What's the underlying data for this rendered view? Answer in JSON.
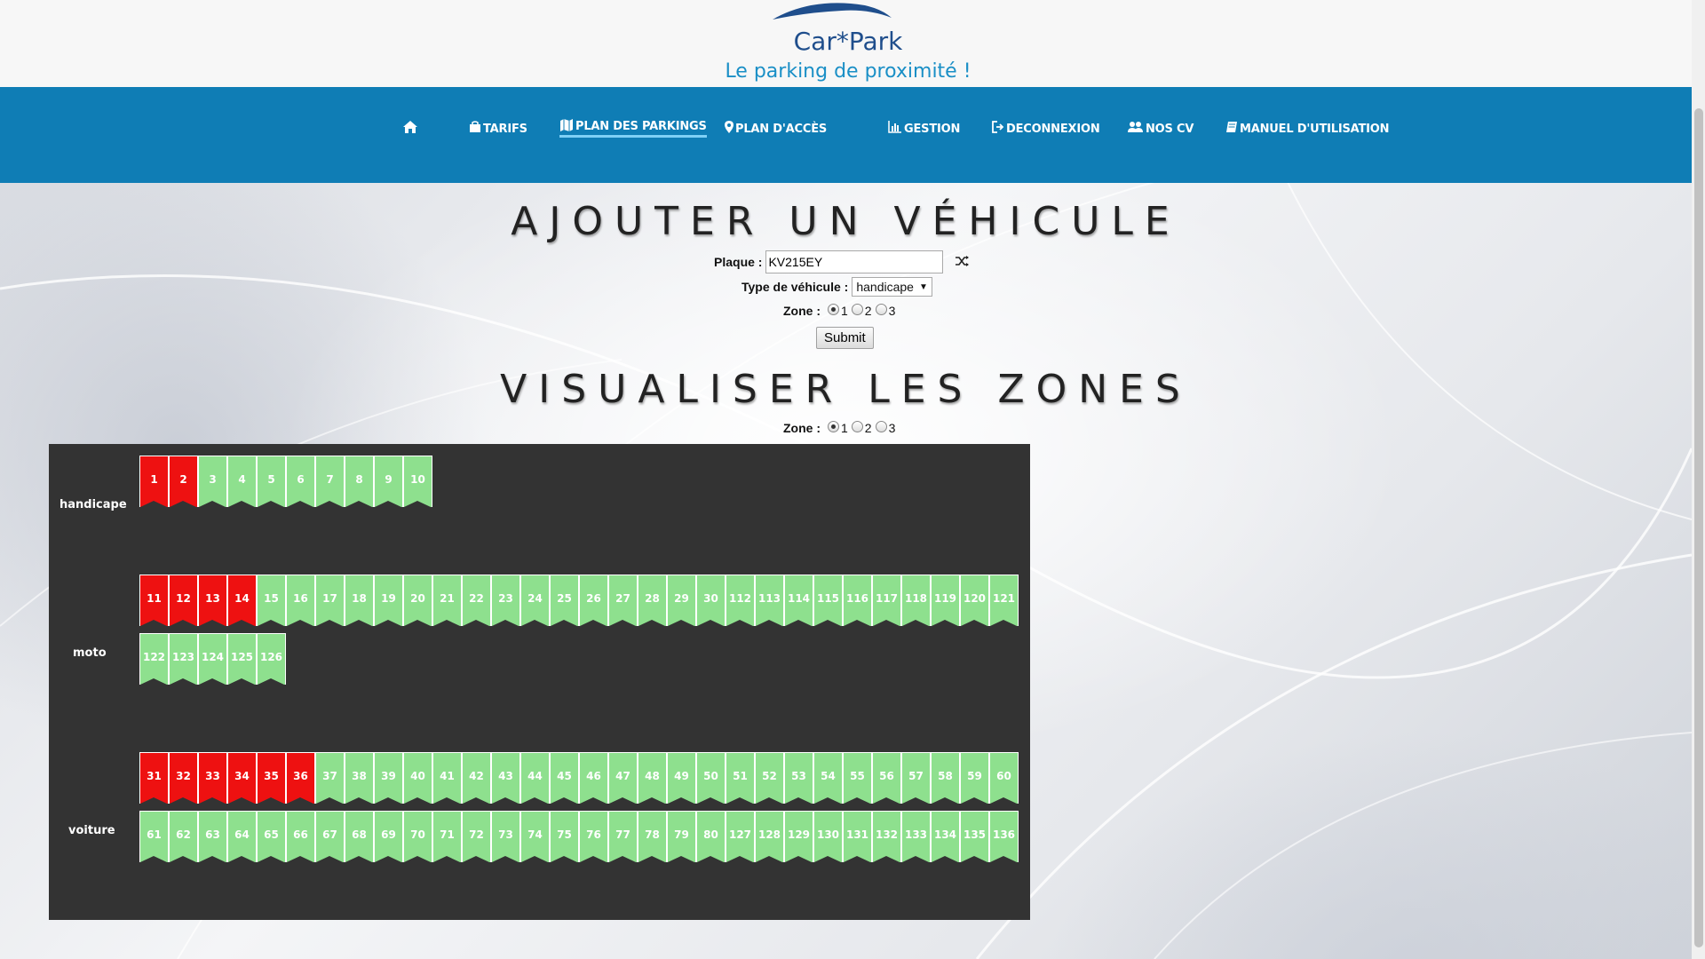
{
  "header": {
    "logo_title": "Car*Park",
    "logo_subtitle": "Le parking de proximité !"
  },
  "nav": {
    "items": [
      {
        "label": "",
        "icon": "home-icon"
      },
      {
        "label": "TARIFS",
        "icon": "shopping-bag-icon"
      },
      {
        "label": "PLAN DES PARKINGS",
        "icon": "map-icon",
        "active": true
      },
      {
        "label": "PLAN D'ACCÈS",
        "icon": "map-marker-icon"
      },
      {
        "label": "GESTION",
        "icon": "bar-chart-icon"
      },
      {
        "label": "DECONNEXION",
        "icon": "sign-out-icon"
      },
      {
        "label": "NOS CV",
        "icon": "users-icon"
      },
      {
        "label": "MANUEL D'UTILISATION",
        "icon": "book-icon"
      }
    ]
  },
  "add_vehicle": {
    "title": "AJOUTER UN VÉHICULE",
    "plate_label": "Plaque :",
    "plate_value": "KV215EY",
    "type_label": "Type de véhicule :",
    "type_value": "handicape",
    "zone_label": "Zone :",
    "zone_options": [
      "1",
      "2",
      "3"
    ],
    "zone_selected": "1",
    "submit_label": "Submit"
  },
  "visualize": {
    "title": "VISUALISER LES ZONES",
    "zone_label": "Zone :",
    "zone_options": [
      "1",
      "2",
      "3"
    ],
    "zone_selected": "1"
  },
  "zones": [
    {
      "name": "handicape",
      "rows": [
        [
          {
            "n": "1",
            "taken": true
          },
          {
            "n": "2",
            "taken": true
          },
          {
            "n": "3",
            "taken": false
          },
          {
            "n": "4",
            "taken": false
          },
          {
            "n": "5",
            "taken": false
          },
          {
            "n": "6",
            "taken": false
          },
          {
            "n": "7",
            "taken": false
          },
          {
            "n": "8",
            "taken": false
          },
          {
            "n": "9",
            "taken": false
          },
          {
            "n": "10",
            "taken": false
          }
        ]
      ]
    },
    {
      "name": "moto",
      "rows": [
        [
          {
            "n": "11",
            "taken": true
          },
          {
            "n": "12",
            "taken": true
          },
          {
            "n": "13",
            "taken": true
          },
          {
            "n": "14",
            "taken": true
          },
          {
            "n": "15",
            "taken": false
          },
          {
            "n": "16",
            "taken": false
          },
          {
            "n": "17",
            "taken": false
          },
          {
            "n": "18",
            "taken": false
          },
          {
            "n": "19",
            "taken": false
          },
          {
            "n": "20",
            "taken": false
          },
          {
            "n": "21",
            "taken": false
          },
          {
            "n": "22",
            "taken": false
          },
          {
            "n": "23",
            "taken": false
          },
          {
            "n": "24",
            "taken": false
          },
          {
            "n": "25",
            "taken": false
          },
          {
            "n": "26",
            "taken": false
          },
          {
            "n": "27",
            "taken": false
          },
          {
            "n": "28",
            "taken": false
          },
          {
            "n": "29",
            "taken": false
          },
          {
            "n": "30",
            "taken": false
          },
          {
            "n": "112",
            "taken": false
          },
          {
            "n": "113",
            "taken": false
          },
          {
            "n": "114",
            "taken": false
          },
          {
            "n": "115",
            "taken": false
          },
          {
            "n": "116",
            "taken": false
          },
          {
            "n": "117",
            "taken": false
          },
          {
            "n": "118",
            "taken": false
          },
          {
            "n": "119",
            "taken": false
          },
          {
            "n": "120",
            "taken": false
          },
          {
            "n": "121",
            "taken": false
          }
        ],
        [
          {
            "n": "122",
            "taken": false
          },
          {
            "n": "123",
            "taken": false
          },
          {
            "n": "124",
            "taken": false
          },
          {
            "n": "125",
            "taken": false
          },
          {
            "n": "126",
            "taken": false
          }
        ]
      ]
    },
    {
      "name": "voiture",
      "rows": [
        [
          {
            "n": "31",
            "taken": true
          },
          {
            "n": "32",
            "taken": true
          },
          {
            "n": "33",
            "taken": true
          },
          {
            "n": "34",
            "taken": true
          },
          {
            "n": "35",
            "taken": true
          },
          {
            "n": "36",
            "taken": true
          },
          {
            "n": "37",
            "taken": false
          },
          {
            "n": "38",
            "taken": false
          },
          {
            "n": "39",
            "taken": false
          },
          {
            "n": "40",
            "taken": false
          },
          {
            "n": "41",
            "taken": false
          },
          {
            "n": "42",
            "taken": false
          },
          {
            "n": "43",
            "taken": false
          },
          {
            "n": "44",
            "taken": false
          },
          {
            "n": "45",
            "taken": false
          },
          {
            "n": "46",
            "taken": false
          },
          {
            "n": "47",
            "taken": false
          },
          {
            "n": "48",
            "taken": false
          },
          {
            "n": "49",
            "taken": false
          },
          {
            "n": "50",
            "taken": false
          },
          {
            "n": "51",
            "taken": false
          },
          {
            "n": "52",
            "taken": false
          },
          {
            "n": "53",
            "taken": false
          },
          {
            "n": "54",
            "taken": false
          },
          {
            "n": "55",
            "taken": false
          },
          {
            "n": "56",
            "taken": false
          },
          {
            "n": "57",
            "taken": false
          },
          {
            "n": "58",
            "taken": false
          },
          {
            "n": "59",
            "taken": false
          },
          {
            "n": "60",
            "taken": false
          }
        ],
        [
          {
            "n": "61",
            "taken": false
          },
          {
            "n": "62",
            "taken": false
          },
          {
            "n": "63",
            "taken": false
          },
          {
            "n": "64",
            "taken": false
          },
          {
            "n": "65",
            "taken": false
          },
          {
            "n": "66",
            "taken": false
          },
          {
            "n": "67",
            "taken": false
          },
          {
            "n": "68",
            "taken": false
          },
          {
            "n": "69",
            "taken": false
          },
          {
            "n": "70",
            "taken": false
          },
          {
            "n": "71",
            "taken": false
          },
          {
            "n": "72",
            "taken": false
          },
          {
            "n": "73",
            "taken": false
          },
          {
            "n": "74",
            "taken": false
          },
          {
            "n": "75",
            "taken": false
          },
          {
            "n": "76",
            "taken": false
          },
          {
            "n": "77",
            "taken": false
          },
          {
            "n": "78",
            "taken": false
          },
          {
            "n": "79",
            "taken": false
          },
          {
            "n": "80",
            "taken": false
          },
          {
            "n": "127",
            "taken": false
          },
          {
            "n": "128",
            "taken": false
          },
          {
            "n": "129",
            "taken": false
          },
          {
            "n": "130",
            "taken": false
          },
          {
            "n": "131",
            "taken": false
          },
          {
            "n": "132",
            "taken": false
          },
          {
            "n": "133",
            "taken": false
          },
          {
            "n": "134",
            "taken": false
          },
          {
            "n": "135",
            "taken": false
          },
          {
            "n": "136",
            "taken": false
          }
        ]
      ]
    }
  ],
  "colors": {
    "nav_bg": "#0f7db5",
    "spot_free": "#8ee08e",
    "spot_taken": "#ee1111",
    "panel_bg": "#333333"
  }
}
